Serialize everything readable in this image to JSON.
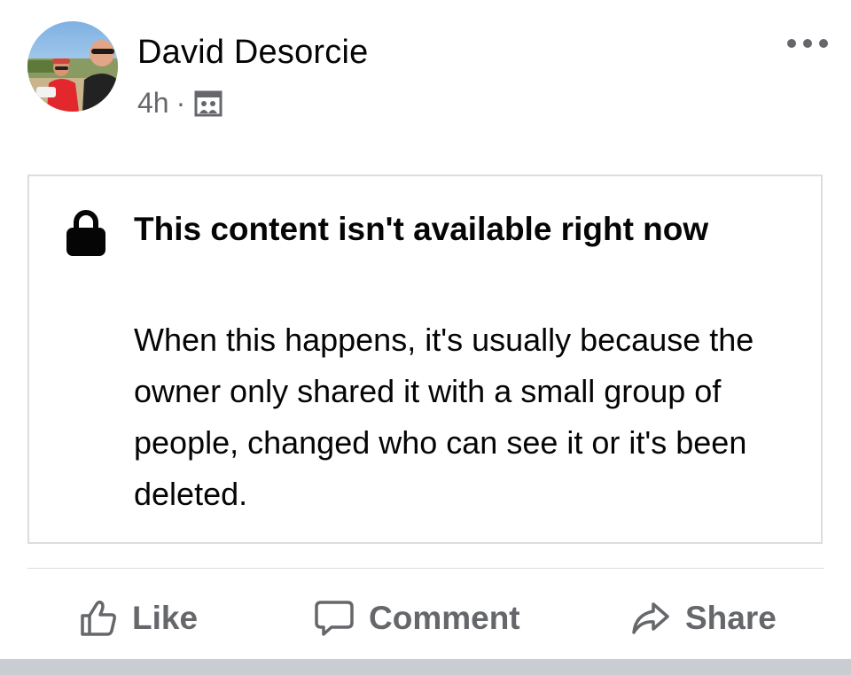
{
  "post": {
    "author_name": "David Desorcie",
    "timestamp": "4h",
    "separator": "·",
    "privacy_icon": "group-privacy-icon",
    "avatar_icon": "profile-photo",
    "more_icon": "more-dots-icon"
  },
  "unavailable": {
    "icon": "lock-icon",
    "title": "This content isn't available right now",
    "body": "When this happens, it's usually because the owner only shared it with a small group of people, changed who can see it or it's been deleted."
  },
  "actions": {
    "like": {
      "label": "Like",
      "icon": "thumbs-up-icon"
    },
    "comment": {
      "label": "Comment",
      "icon": "comment-bubble-icon"
    },
    "share": {
      "label": "Share",
      "icon": "share-arrow-icon"
    }
  },
  "colors": {
    "text_primary": "#050505",
    "text_secondary": "#65676b",
    "border": "#dadde1",
    "strip": "#c9ccd1"
  }
}
